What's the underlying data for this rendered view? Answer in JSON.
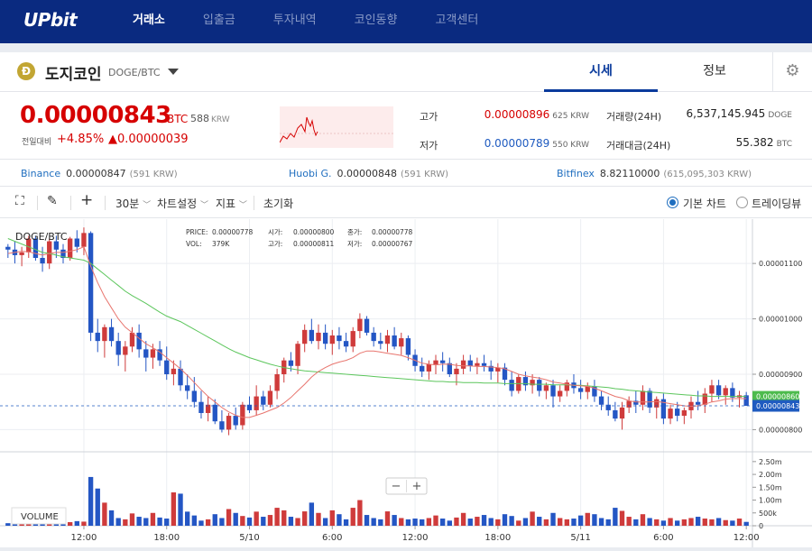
{
  "nav": {
    "logo": "UPbit",
    "items": [
      "거래소",
      "입출금",
      "투자내역",
      "코인동향",
      "고객센터"
    ]
  },
  "coin": {
    "icon": "dogecoin-icon",
    "icon_letter": "Ð",
    "name": "도지코인",
    "pair": "DOGE/BTC"
  },
  "tabs": [
    "시세",
    "정보"
  ],
  "price": {
    "value": "0.00000843",
    "unit": "BTC",
    "krw": "588",
    "krw_unit": "KRW",
    "change_label": "전일대비",
    "change_pct": "+4.85%",
    "change_abs": "▲0.00000039"
  },
  "stats": {
    "high_label": "고가",
    "high": "0.00000896",
    "high_krw": "625 KRW",
    "low_label": "저가",
    "low": "0.00000789",
    "low_krw": "550 KRW",
    "vol_label": "거래량(24H)",
    "vol": "6,537,145.945",
    "vol_unit": "DOGE",
    "amt_label": "거래대금(24H)",
    "amt": "55.382",
    "amt_unit": "BTC"
  },
  "exchanges": [
    {
      "name": "Binance",
      "value": "0.00000847",
      "krw": "(591 KRW)"
    },
    {
      "name": "Huobi G.",
      "value": "0.00000848",
      "krw": "(591 KRW)"
    },
    {
      "name": "Bitfinex",
      "value": "8.82110000",
      "krw": "(615,095,303 KRW)"
    }
  ],
  "toolbar": {
    "interval": "30분",
    "settings": "차트설정",
    "indicators": "지표",
    "reset": "초기화",
    "radio_basic": "기본 차트",
    "radio_tv": "트레이딩뷰"
  },
  "chart_data": {
    "type": "candlestick",
    "title": "DOGE/BTC",
    "info": {
      "price_label": "PRICE:",
      "price": "0.00000778",
      "open_label": "시가:",
      "open": "0.00000800",
      "close_label": "종가:",
      "close": "0.00000778",
      "vol_label": "VOL:",
      "vol": "379K",
      "high_label": "고가:",
      "high": "0.00000811",
      "low_label": "저가:",
      "low": "0.00000767"
    },
    "y_ticks": [
      "0.00001100",
      "0.00001000",
      "0.00000900",
      "0.00000800"
    ],
    "y_tick_values": [
      1100,
      1000,
      900,
      800
    ],
    "ylim": [
      760,
      1180
    ],
    "current_price": "0.00000843",
    "current_value": 843,
    "ma_tag": "0.00000860",
    "ma_value": 860,
    "volume_label": "VOLUME",
    "volume_ticks": [
      "2.50m",
      "2.00m",
      "1.50m",
      "1.00m",
      "500k",
      "0"
    ],
    "volume_tick_values": [
      2500,
      2000,
      1500,
      1000,
      500,
      0
    ],
    "x_ticks": [
      "12:00",
      "18:00",
      "5/10",
      "6:00",
      "12:00",
      "18:00",
      "5/11",
      "6:00",
      "12:00"
    ],
    "x_tick_index": [
      11,
      23,
      35,
      47,
      59,
      71,
      83,
      95,
      107
    ],
    "candles_ohlc": [
      [
        1130,
        1135,
        1110,
        1125
      ],
      [
        1125,
        1140,
        1100,
        1115
      ],
      [
        1115,
        1130,
        1095,
        1120
      ],
      [
        1120,
        1150,
        1110,
        1145
      ],
      [
        1145,
        1150,
        1105,
        1110
      ],
      [
        1110,
        1130,
        1085,
        1100
      ],
      [
        1100,
        1145,
        1090,
        1140
      ],
      [
        1140,
        1150,
        1110,
        1125
      ],
      [
        1125,
        1135,
        1100,
        1110
      ],
      [
        1110,
        1148,
        1105,
        1145
      ],
      [
        1145,
        1160,
        1120,
        1130
      ],
      [
        1130,
        1165,
        1115,
        1155
      ],
      [
        1155,
        1158,
        960,
        975
      ],
      [
        975,
        1000,
        940,
        960
      ],
      [
        960,
        990,
        930,
        985
      ],
      [
        985,
        1000,
        950,
        960
      ],
      [
        960,
        975,
        915,
        935
      ],
      [
        935,
        960,
        905,
        950
      ],
      [
        950,
        985,
        940,
        975
      ],
      [
        975,
        990,
        930,
        945
      ],
      [
        945,
        960,
        905,
        930
      ],
      [
        930,
        955,
        910,
        945
      ],
      [
        945,
        960,
        915,
        925
      ],
      [
        925,
        950,
        890,
        900
      ],
      [
        900,
        925,
        880,
        910
      ],
      [
        910,
        925,
        870,
        880
      ],
      [
        880,
        900,
        855,
        870
      ],
      [
        870,
        895,
        840,
        850
      ],
      [
        850,
        870,
        820,
        830
      ],
      [
        830,
        860,
        815,
        845
      ],
      [
        845,
        855,
        810,
        815
      ],
      [
        815,
        835,
        795,
        800
      ],
      [
        800,
        830,
        790,
        825
      ],
      [
        825,
        840,
        800,
        808
      ],
      [
        808,
        850,
        800,
        845
      ],
      [
        845,
        860,
        830,
        835
      ],
      [
        835,
        880,
        825,
        860
      ],
      [
        860,
        870,
        835,
        845
      ],
      [
        845,
        880,
        840,
        870
      ],
      [
        870,
        910,
        855,
        900
      ],
      [
        900,
        930,
        885,
        925
      ],
      [
        925,
        940,
        905,
        915
      ],
      [
        915,
        960,
        900,
        955
      ],
      [
        955,
        990,
        940,
        980
      ],
      [
        980,
        1000,
        955,
        960
      ],
      [
        960,
        990,
        945,
        975
      ],
      [
        975,
        990,
        945,
        955
      ],
      [
        955,
        980,
        935,
        970
      ],
      [
        970,
        985,
        945,
        960
      ],
      [
        960,
        975,
        940,
        950
      ],
      [
        950,
        985,
        940,
        978
      ],
      [
        978,
        1010,
        965,
        1000
      ],
      [
        1000,
        1005,
        970,
        975
      ],
      [
        975,
        985,
        950,
        960
      ],
      [
        960,
        975,
        945,
        955
      ],
      [
        955,
        980,
        940,
        970
      ],
      [
        970,
        985,
        945,
        950
      ],
      [
        950,
        975,
        935,
        965
      ],
      [
        965,
        970,
        925,
        935
      ],
      [
        935,
        945,
        905,
        915
      ],
      [
        915,
        930,
        895,
        905
      ],
      [
        905,
        925,
        890,
        918
      ],
      [
        918,
        935,
        900,
        925
      ],
      [
        925,
        940,
        905,
        920
      ],
      [
        920,
        930,
        895,
        900
      ],
      [
        900,
        920,
        880,
        910
      ],
      [
        910,
        935,
        900,
        925
      ],
      [
        925,
        935,
        905,
        915
      ],
      [
        915,
        930,
        900,
        920
      ],
      [
        920,
        935,
        905,
        915
      ],
      [
        915,
        925,
        890,
        905
      ],
      [
        905,
        920,
        885,
        912
      ],
      [
        912,
        920,
        880,
        890
      ],
      [
        890,
        905,
        860,
        870
      ],
      [
        870,
        900,
        865,
        895
      ],
      [
        895,
        905,
        870,
        880
      ],
      [
        880,
        900,
        865,
        890
      ],
      [
        890,
        895,
        860,
        870
      ],
      [
        870,
        885,
        855,
        880
      ],
      [
        880,
        890,
        840,
        860
      ],
      [
        860,
        880,
        850,
        870
      ],
      [
        870,
        890,
        860,
        885
      ],
      [
        885,
        900,
        865,
        875
      ],
      [
        875,
        890,
        855,
        868
      ],
      [
        868,
        885,
        855,
        878
      ],
      [
        878,
        890,
        850,
        860
      ],
      [
        860,
        870,
        835,
        845
      ],
      [
        845,
        860,
        825,
        835
      ],
      [
        835,
        850,
        815,
        820
      ],
      [
        820,
        850,
        800,
        840
      ],
      [
        840,
        860,
        830,
        852
      ],
      [
        852,
        870,
        830,
        845
      ],
      [
        845,
        880,
        835,
        870
      ],
      [
        870,
        875,
        830,
        840
      ],
      [
        840,
        860,
        820,
        855
      ],
      [
        855,
        865,
        810,
        820
      ],
      [
        820,
        845,
        810,
        838
      ],
      [
        838,
        850,
        815,
        825
      ],
      [
        825,
        840,
        810,
        835
      ],
      [
        835,
        860,
        820,
        850
      ],
      [
        850,
        870,
        835,
        845
      ],
      [
        845,
        875,
        830,
        865
      ],
      [
        865,
        890,
        850,
        880
      ],
      [
        880,
        890,
        855,
        862
      ],
      [
        862,
        880,
        845,
        875
      ],
      [
        875,
        885,
        850,
        858
      ],
      [
        858,
        870,
        840,
        862
      ],
      [
        862,
        868,
        843,
        843
      ]
    ],
    "volume_k": [
      100,
      80,
      60,
      110,
      90,
      70,
      150,
      130,
      120,
      140,
      180,
      160,
      1900,
      1450,
      900,
      600,
      300,
      250,
      480,
      350,
      300,
      500,
      320,
      280,
      1300,
      1250,
      550,
      400,
      200,
      250,
      450,
      300,
      650,
      500,
      380,
      320,
      550,
      350,
      420,
      700,
      600,
      350,
      300,
      560,
      900,
      500,
      300,
      600,
      450,
      250,
      700,
      1000,
      420,
      300,
      250,
      560,
      420,
      300,
      250,
      280,
      250,
      300,
      400,
      280,
      200,
      320,
      500,
      280,
      350,
      420,
      300,
      250,
      450,
      380,
      200,
      300,
      550,
      350,
      250,
      500,
      300,
      250,
      280,
      400,
      500,
      450,
      300,
      250,
      700,
      580,
      350,
      250,
      450,
      300,
      250,
      200,
      300,
      200,
      250,
      300,
      350,
      280,
      250,
      300,
      220,
      200,
      280,
      150
    ],
    "ma_slow": [
      1145,
      1140,
      1135,
      1130,
      1125,
      1120,
      1118,
      1115,
      1112,
      1110,
      1108,
      1106,
      1100,
      1090,
      1080,
      1070,
      1060,
      1050,
      1042,
      1035,
      1028,
      1020,
      1012,
      1005,
      1000,
      995,
      988,
      981,
      974,
      967,
      960,
      953,
      946,
      940,
      935,
      930,
      926,
      922,
      918,
      915,
      912,
      910,
      908,
      906,
      905,
      904,
      903,
      902,
      901,
      900,
      899,
      898,
      897,
      896,
      895,
      894,
      893,
      892,
      891,
      890,
      889,
      888,
      887,
      887,
      886,
      886,
      885,
      885,
      885,
      884,
      884,
      884,
      883,
      883,
      883,
      883,
      882,
      882,
      882,
      881,
      881,
      881,
      880,
      880,
      879,
      878,
      877,
      876,
      874,
      873,
      871,
      870,
      869,
      868,
      867,
      866,
      865,
      864,
      863,
      862,
      861,
      861,
      860,
      860,
      860,
      860,
      860,
      860
    ],
    "ma_fast": [
      1118,
      1120,
      1122,
      1121,
      1118,
      1115,
      1118,
      1120,
      1120,
      1122,
      1125,
      1130,
      1095,
      1065,
      1040,
      1020,
      1000,
      985,
      975,
      965,
      955,
      948,
      940,
      930,
      920,
      910,
      898,
      885,
      872,
      860,
      850,
      840,
      832,
      826,
      822,
      822,
      826,
      830,
      835,
      840,
      848,
      858,
      870,
      882,
      895,
      905,
      912,
      918,
      922,
      925,
      930,
      938,
      942,
      942,
      940,
      938,
      936,
      934,
      930,
      925,
      920,
      918,
      917,
      918,
      918,
      916,
      915,
      915,
      914,
      914,
      913,
      912,
      910,
      905,
      900,
      897,
      895,
      893,
      890,
      886,
      884,
      882,
      880,
      879,
      878,
      875,
      870,
      865,
      860,
      857,
      852,
      850,
      850,
      850,
      851,
      849,
      847,
      845,
      843,
      842,
      843,
      846,
      850,
      852,
      855,
      856,
      856,
      856
    ]
  }
}
